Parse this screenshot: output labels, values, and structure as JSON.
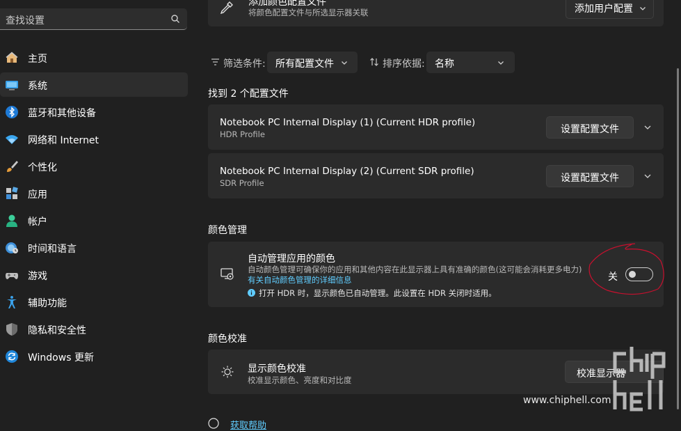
{
  "sidebar": {
    "search_placeholder": "查找设置",
    "items": [
      {
        "label": "主页"
      },
      {
        "label": "系统"
      },
      {
        "label": "蓝牙和其他设备"
      },
      {
        "label": "网络和 Internet"
      },
      {
        "label": "个性化"
      },
      {
        "label": "应用"
      },
      {
        "label": "帐户"
      },
      {
        "label": "时间和语言"
      },
      {
        "label": "游戏"
      },
      {
        "label": "辅助功能"
      },
      {
        "label": "隐私和安全性"
      },
      {
        "label": "Windows 更新"
      }
    ],
    "active_item": "系统"
  },
  "top_card": {
    "title": "添加颜色配置文件",
    "subtitle": "将颜色配置文件与所选显示器关联",
    "button": "添加用户配置"
  },
  "filter": {
    "label": "筛选条件:",
    "value": "所有配置文件",
    "sort_label": "排序依据:",
    "sort_value": "名称"
  },
  "profiles": {
    "heading": "找到 2 个配置文件",
    "items": [
      {
        "title": "Notebook PC Internal Display (1) (Current HDR profile)",
        "subtitle": "HDR Profile",
        "button": "设置配置文件"
      },
      {
        "title": "Notebook PC Internal Display (2) (Current SDR profile)",
        "subtitle": "SDR Profile",
        "button": "设置配置文件"
      }
    ]
  },
  "color_management": {
    "heading": "颜色管理",
    "title": "自动管理应用的颜色",
    "description": "自动颜色管理可确保你的应用和其他内容在此显示器上具有准确的颜色(这可能会消耗更多电力)",
    "link": "有关自动颜色管理的详细信息",
    "info": "打开 HDR 时，显示颜色已自动管理。此设置在 HDR 关闭时适用。",
    "toggle_label": "关",
    "toggle_on": false
  },
  "calibration": {
    "heading": "颜色校准",
    "title": "显示颜色校准",
    "subtitle": "校准显示颜色、亮度和对比度",
    "button": "校准显示器"
  },
  "help": {
    "label": "获取帮助"
  },
  "watermark": {
    "site": "www.chiphell.com",
    "logo": "chiphell"
  },
  "colors": {
    "accent": "#60cdff",
    "annotation": "#c8102e"
  }
}
